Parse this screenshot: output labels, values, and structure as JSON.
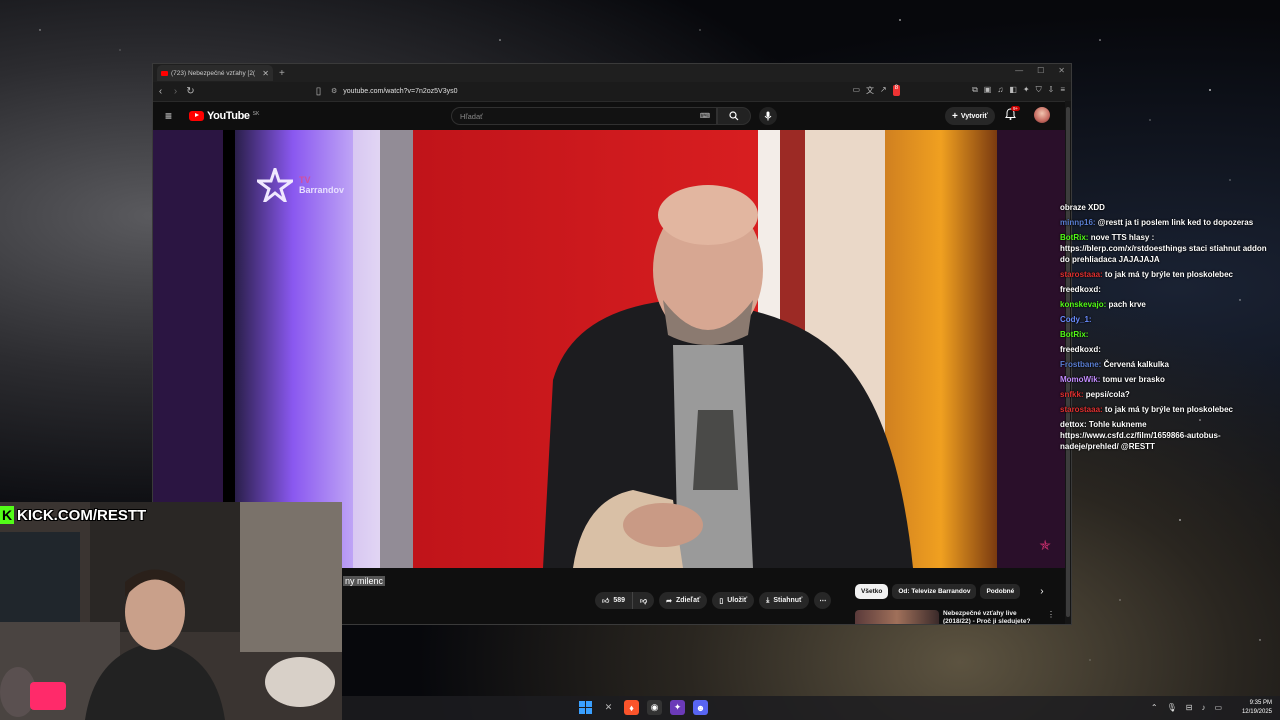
{
  "browser": {
    "tab_title": "(723) Nebezpečné vzťahy [2(",
    "tab_close": "✕",
    "new_tab": "+",
    "url": "youtube.com/watch?v=7n2oz5V3ys0",
    "ext_badge": "8"
  },
  "youtube": {
    "logo_text": "YouTube",
    "region": "SK",
    "search_placeholder": "Hľadať",
    "create_label": "Vytvoriť",
    "notifications_badge": "9+",
    "video_channel_logo": "Barrandov",
    "video_channel_logo_line1": "TV",
    "title_fragment": "ny milenc",
    "actions": {
      "likes": "589",
      "share": "Zdieľať",
      "save": "Uložiť",
      "download": "Stiahnuť"
    },
    "chips": [
      "Všetko",
      "Od: Televize Barrandov",
      "Podobné"
    ],
    "recommendation": {
      "title": "Nebezpečné vzťahy live (2018/22) - Proč ji sledujete?"
    }
  },
  "kick": {
    "label": "KICK.COM/RESTT"
  },
  "chat": [
    {
      "user": "",
      "text": "obraze XDD",
      "color": "#ffffff"
    },
    {
      "user": "minnp16:",
      "text": "@restt ja ti poslem link ked to dopozeras",
      "color": "#5a7fd4"
    },
    {
      "user": "BotRix:",
      "text": "nove TTS hlasy : https://blerp.com/x/rstdoesthings staci stiahnut addon do prehliadaca JAJAJAJA",
      "color": "#53fc18"
    },
    {
      "user": "starostaaa:",
      "text": "to jak má ty brýle ten ploskolebec",
      "color": "#e03030"
    },
    {
      "user": "freedkoxd:",
      "text": "",
      "color": "#ffffff"
    },
    {
      "user": "konskevajo:",
      "text": "pach krve",
      "color": "#53fc18"
    },
    {
      "user": "Cody_1:",
      "text": "",
      "color": "#6a8cff"
    },
    {
      "user": "BotRix:",
      "text": "",
      "color": "#53fc18"
    },
    {
      "user": "freedkoxd:",
      "text": "",
      "color": "#ffffff"
    },
    {
      "user": "Frostbane:",
      "text": "Červená kalkulka",
      "color": "#5a7fd4"
    },
    {
      "user": "MomoWik:",
      "text": "tomu ver brasko",
      "color": "#c38cff"
    },
    {
      "user": "snfkk:",
      "text": "pepsi/cola?",
      "color": "#e03030"
    },
    {
      "user": "starostaaa:",
      "text": "to jak má ty brýle ten ploskolebec",
      "color": "#e03030"
    },
    {
      "user": "dettox:",
      "text": "Tohle kukneme https://www.csfd.cz/film/1659866-autobus-nadeje/prehled/ @RESTT",
      "color": "#ffffff"
    }
  ],
  "taskbar": {
    "time": "9:35 PM",
    "date": "12/19/2025"
  }
}
